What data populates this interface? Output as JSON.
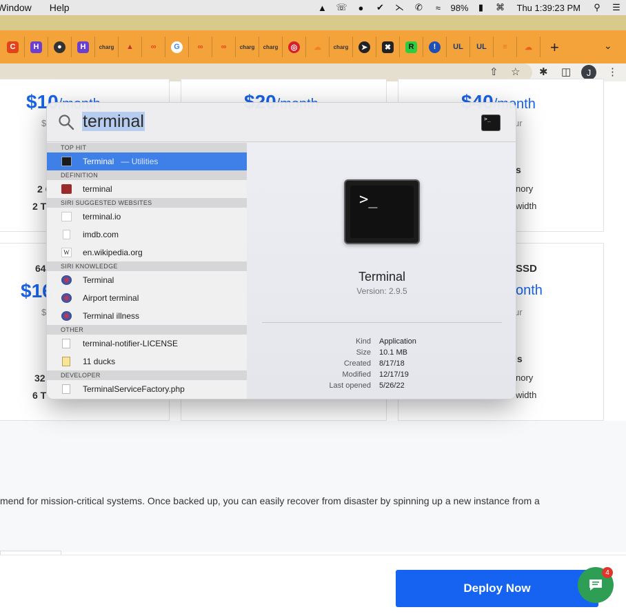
{
  "menubar": {
    "items": [
      "Window",
      "Help"
    ],
    "battery": "98%",
    "clock": "Thu 1:39:23 PM"
  },
  "browser": {
    "avatar_initial": "J",
    "tab_favicons": [
      "cloudflare-flame-icon",
      "h-icon",
      "globe-icon",
      "h-icon",
      "charg-icon",
      "sail-icon",
      "infinity-icon",
      "google-icon",
      "infinity-icon",
      "infinity-icon",
      "charg-icon",
      "charg-icon",
      "target-icon",
      "cloud-icon",
      "charg-icon",
      "rocket-icon",
      "x-icon",
      "r-icon",
      "shield-icon",
      "ul-icon",
      "ul-icon",
      "stack-icon",
      "cloud-icon"
    ]
  },
  "page": {
    "plans_top": [
      {
        "price": "$10",
        "unit": "/month"
      },
      {
        "price": "$20",
        "unit": "/month"
      },
      {
        "price": "$40",
        "unit": "/month"
      }
    ],
    "plan_sub_right": "ur",
    "plans_bottom": [
      {
        "price": "$16"
      },
      {
        "price": "",
        "unit": "onth"
      }
    ],
    "partial_specs": {
      "top_left": [
        "$",
        "2 C",
        "2 T"
      ],
      "top_right": [
        "s",
        "nory",
        "width"
      ],
      "bottom_left": [
        "64",
        "$",
        "32",
        "6 T"
      ],
      "bottom_right": [
        "SSD",
        "ur",
        "ls",
        "nory",
        "width"
      ]
    },
    "body_text": "mend for mission-critical systems. Once backed up, you can easily recover from disaster by spinning up a new instance from a",
    "deploy_label": "Deploy Now",
    "chat_badge": "4"
  },
  "spotlight": {
    "query": "terminal",
    "sections": [
      {
        "title": "TOP HIT",
        "rows": [
          {
            "label": "Terminal",
            "sub": "— Utilities",
            "icon": "terminal-icon",
            "selected": true
          }
        ]
      },
      {
        "title": "DEFINITION",
        "rows": [
          {
            "label": "terminal",
            "icon": "dictionary-icon"
          }
        ]
      },
      {
        "title": "SIRI SUGGESTED WEBSITES",
        "rows": [
          {
            "label": "terminal.io",
            "icon": "website-icon"
          },
          {
            "label": "imdb.com",
            "icon": "website-icon"
          },
          {
            "label": "en.wikipedia.org",
            "icon": "wikipedia-icon"
          }
        ]
      },
      {
        "title": "SIRI KNOWLEDGE",
        "rows": [
          {
            "label": "Terminal",
            "icon": "siri-icon"
          },
          {
            "label": "Airport terminal",
            "icon": "siri-icon"
          },
          {
            "label": "Terminal illness",
            "icon": "siri-icon"
          }
        ]
      },
      {
        "title": "OTHER",
        "rows": [
          {
            "label": "terminal-notifier-LICENSE",
            "icon": "document-icon"
          },
          {
            "label": "11 ducks",
            "icon": "note-icon"
          }
        ]
      },
      {
        "title": "DEVELOPER",
        "rows": [
          {
            "label": "TerminalServiceFactory.php",
            "icon": "php-file-icon"
          }
        ]
      }
    ],
    "preview": {
      "prompt": ">_",
      "name": "Terminal",
      "version": "Version: 2.9.5",
      "meta": [
        {
          "k": "Kind",
          "v": "Application"
        },
        {
          "k": "Size",
          "v": "10.1 MB"
        },
        {
          "k": "Created",
          "v": "8/17/18"
        },
        {
          "k": "Modified",
          "v": "12/17/19"
        },
        {
          "k": "Last opened",
          "v": "5/26/22"
        }
      ]
    }
  }
}
